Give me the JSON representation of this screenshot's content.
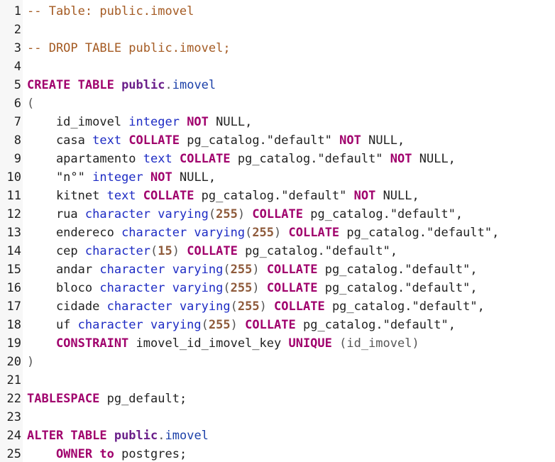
{
  "lines": [
    {
      "n": "1",
      "tokens": [
        {
          "t": "-- Table: public.imovel",
          "c": "comment"
        }
      ]
    },
    {
      "n": "2",
      "tokens": []
    },
    {
      "n": "3",
      "tokens": [
        {
          "t": "-- DROP TABLE public.imovel;",
          "c": "comment"
        }
      ]
    },
    {
      "n": "4",
      "tokens": []
    },
    {
      "n": "5",
      "tokens": [
        {
          "t": "CREATE TABLE ",
          "c": "kw"
        },
        {
          "t": "public",
          "c": "schema"
        },
        {
          "t": ".",
          "c": "punct"
        },
        {
          "t": "imovel",
          "c": "obj"
        }
      ]
    },
    {
      "n": "6",
      "tokens": [
        {
          "t": "(",
          "c": "punct"
        }
      ]
    },
    {
      "n": "7",
      "tokens": [
        {
          "t": "    id_imovel ",
          "c": "ident"
        },
        {
          "t": "integer ",
          "c": "type"
        },
        {
          "t": "NOT ",
          "c": "kw"
        },
        {
          "t": "NULL,",
          "c": "ident"
        }
      ]
    },
    {
      "n": "8",
      "tokens": [
        {
          "t": "    casa ",
          "c": "ident"
        },
        {
          "t": "text ",
          "c": "type"
        },
        {
          "t": "COLLATE ",
          "c": "kw"
        },
        {
          "t": "pg_catalog.\"default\" ",
          "c": "str"
        },
        {
          "t": "NOT ",
          "c": "kw"
        },
        {
          "t": "NULL,",
          "c": "ident"
        }
      ]
    },
    {
      "n": "9",
      "tokens": [
        {
          "t": "    apartamento ",
          "c": "ident"
        },
        {
          "t": "text ",
          "c": "type"
        },
        {
          "t": "COLLATE ",
          "c": "kw"
        },
        {
          "t": "pg_catalog.\"default\" ",
          "c": "str"
        },
        {
          "t": "NOT ",
          "c": "kw"
        },
        {
          "t": "NULL,",
          "c": "ident"
        }
      ]
    },
    {
      "n": "10",
      "tokens": [
        {
          "t": "    \"n°\" ",
          "c": "ident"
        },
        {
          "t": "integer ",
          "c": "type"
        },
        {
          "t": "NOT ",
          "c": "kw"
        },
        {
          "t": "NULL,",
          "c": "ident"
        }
      ]
    },
    {
      "n": "11",
      "tokens": [
        {
          "t": "    kitnet ",
          "c": "ident"
        },
        {
          "t": "text ",
          "c": "type"
        },
        {
          "t": "COLLATE ",
          "c": "kw"
        },
        {
          "t": "pg_catalog.\"default\" ",
          "c": "str"
        },
        {
          "t": "NOT ",
          "c": "kw"
        },
        {
          "t": "NULL,",
          "c": "ident"
        }
      ]
    },
    {
      "n": "12",
      "tokens": [
        {
          "t": "    rua ",
          "c": "ident"
        },
        {
          "t": "character varying",
          "c": "type"
        },
        {
          "t": "(",
          "c": "punct"
        },
        {
          "t": "255",
          "c": "num"
        },
        {
          "t": ") ",
          "c": "punct"
        },
        {
          "t": "COLLATE ",
          "c": "kw"
        },
        {
          "t": "pg_catalog.\"default\",",
          "c": "str"
        }
      ]
    },
    {
      "n": "13",
      "tokens": [
        {
          "t": "    endereco ",
          "c": "ident"
        },
        {
          "t": "character varying",
          "c": "type"
        },
        {
          "t": "(",
          "c": "punct"
        },
        {
          "t": "255",
          "c": "num"
        },
        {
          "t": ") ",
          "c": "punct"
        },
        {
          "t": "COLLATE ",
          "c": "kw"
        },
        {
          "t": "pg_catalog.\"default\",",
          "c": "str"
        }
      ]
    },
    {
      "n": "14",
      "tokens": [
        {
          "t": "    cep ",
          "c": "ident"
        },
        {
          "t": "character",
          "c": "type"
        },
        {
          "t": "(",
          "c": "punct"
        },
        {
          "t": "15",
          "c": "num"
        },
        {
          "t": ") ",
          "c": "punct"
        },
        {
          "t": "COLLATE ",
          "c": "kw"
        },
        {
          "t": "pg_catalog.\"default\",",
          "c": "str"
        }
      ]
    },
    {
      "n": "15",
      "tokens": [
        {
          "t": "    andar ",
          "c": "ident"
        },
        {
          "t": "character varying",
          "c": "type"
        },
        {
          "t": "(",
          "c": "punct"
        },
        {
          "t": "255",
          "c": "num"
        },
        {
          "t": ") ",
          "c": "punct"
        },
        {
          "t": "COLLATE ",
          "c": "kw"
        },
        {
          "t": "pg_catalog.\"default\",",
          "c": "str"
        }
      ]
    },
    {
      "n": "16",
      "tokens": [
        {
          "t": "    bloco ",
          "c": "ident"
        },
        {
          "t": "character varying",
          "c": "type"
        },
        {
          "t": "(",
          "c": "punct"
        },
        {
          "t": "255",
          "c": "num"
        },
        {
          "t": ") ",
          "c": "punct"
        },
        {
          "t": "COLLATE ",
          "c": "kw"
        },
        {
          "t": "pg_catalog.\"default\",",
          "c": "str"
        }
      ]
    },
    {
      "n": "17",
      "tokens": [
        {
          "t": "    cidade ",
          "c": "ident"
        },
        {
          "t": "character varying",
          "c": "type"
        },
        {
          "t": "(",
          "c": "punct"
        },
        {
          "t": "255",
          "c": "num"
        },
        {
          "t": ") ",
          "c": "punct"
        },
        {
          "t": "COLLATE ",
          "c": "kw"
        },
        {
          "t": "pg_catalog.\"default\",",
          "c": "str"
        }
      ]
    },
    {
      "n": "18",
      "tokens": [
        {
          "t": "    uf ",
          "c": "ident"
        },
        {
          "t": "character varying",
          "c": "type"
        },
        {
          "t": "(",
          "c": "punct"
        },
        {
          "t": "255",
          "c": "num"
        },
        {
          "t": ") ",
          "c": "punct"
        },
        {
          "t": "COLLATE ",
          "c": "kw"
        },
        {
          "t": "pg_catalog.\"default\",",
          "c": "str"
        }
      ]
    },
    {
      "n": "19",
      "tokens": [
        {
          "t": "    CONSTRAINT ",
          "c": "kw"
        },
        {
          "t": "imovel_id_imovel_key ",
          "c": "ident"
        },
        {
          "t": "UNIQUE ",
          "c": "kw"
        },
        {
          "t": "(id_imovel)",
          "c": "punct"
        }
      ]
    },
    {
      "n": "20",
      "tokens": [
        {
          "t": ")",
          "c": "punct"
        }
      ]
    },
    {
      "n": "21",
      "tokens": []
    },
    {
      "n": "22",
      "tokens": [
        {
          "t": "TABLESPACE ",
          "c": "kw"
        },
        {
          "t": "pg_default;",
          "c": "ident"
        }
      ]
    },
    {
      "n": "23",
      "tokens": []
    },
    {
      "n": "24",
      "tokens": [
        {
          "t": "ALTER TABLE ",
          "c": "kw"
        },
        {
          "t": "public",
          "c": "schema"
        },
        {
          "t": ".",
          "c": "punct"
        },
        {
          "t": "imovel",
          "c": "obj"
        }
      ]
    },
    {
      "n": "25",
      "tokens": [
        {
          "t": "    OWNER ",
          "c": "kw"
        },
        {
          "t": "to ",
          "c": "kw"
        },
        {
          "t": "postgres;",
          "c": "ident"
        }
      ]
    }
  ]
}
